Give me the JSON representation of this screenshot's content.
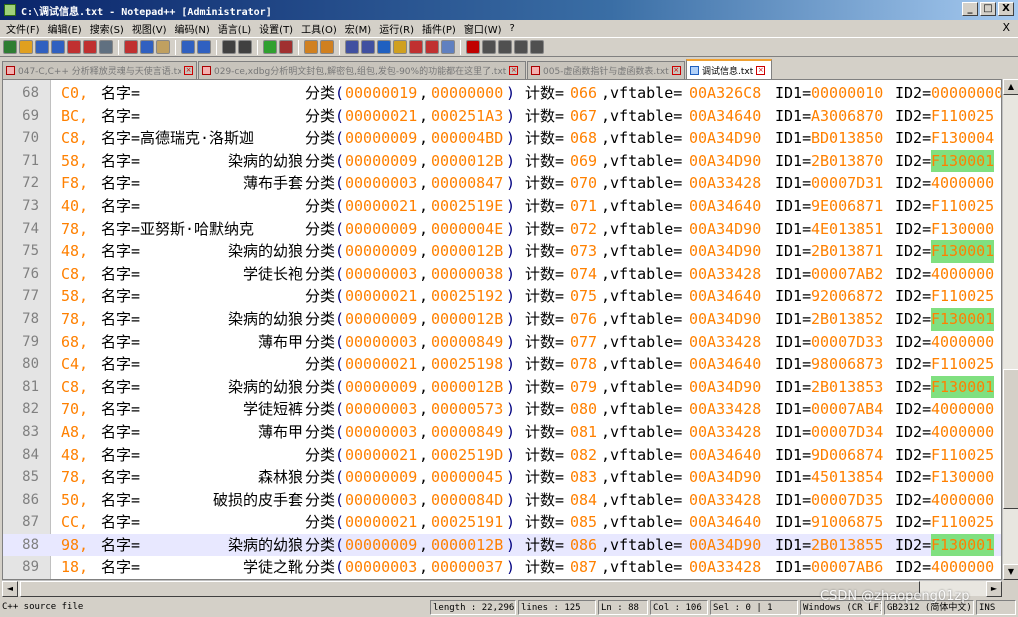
{
  "window": {
    "title": "C:\\调试信息.txt - Notepad++ [Administrator]",
    "buttons": [
      "_",
      "□",
      "X"
    ]
  },
  "menu": {
    "items": [
      "文件(F)",
      "编辑(E)",
      "搜索(S)",
      "视图(V)",
      "编码(N)",
      "语言(L)",
      "设置(T)",
      "工具(O)",
      "宏(M)",
      "运行(R)",
      "插件(P)",
      "窗口(W)",
      "?"
    ],
    "close": "X"
  },
  "toolbar": {
    "icons": [
      "new-file-icon",
      "open-file-icon",
      "save-icon",
      "save-all-icon",
      "close-icon",
      "close-all-icon",
      "print-icon",
      "cut-icon",
      "copy-icon",
      "paste-icon",
      "undo-icon",
      "redo-icon",
      "find-icon",
      "replace-icon",
      "zoom-in-icon",
      "zoom-out-icon",
      "sync-v-icon",
      "sync-h-icon",
      "wrap-icon",
      "all-chars-icon",
      "indent-guide-icon",
      "doc-map-icon",
      "function-list-icon",
      "folder-workspace-icon",
      "monitor-icon",
      "record-macro-icon",
      "stop-macro-icon",
      "play-macro-icon",
      "run-macro-icon",
      "save-macro-icon"
    ],
    "colors": [
      "#2e7d32",
      "#e0a020",
      "#3060c0",
      "#3060c0",
      "#c03030",
      "#c03030",
      "#607080",
      "#c03030",
      "#3060c0",
      "#c0a060",
      "#3060c0",
      "#3060c0",
      "#404040",
      "#404040",
      "#30a030",
      "#a03030",
      "#d08020",
      "#d08020",
      "#4050a0",
      "#4050a0",
      "#2060c0",
      "#d0a020",
      "#c03030",
      "#c03030",
      "#6080c0",
      "#c00000",
      "#505050",
      "#505050",
      "#505050",
      "#505050"
    ]
  },
  "tabs": [
    {
      "label": "047-C,C++ 分析释放灵魂与天使言语.txt",
      "active": false
    },
    {
      "label": "029-ce,xdbg分析明文封包,解密包,组包,发包-90%的功能都在这里了.txt",
      "active": false
    },
    {
      "label": "005-虚函数指针与虚函数表.txt",
      "active": false
    },
    {
      "label": "调试信息.txt",
      "active": true
    }
  ],
  "editor": {
    "current_line": 88,
    "rows": [
      {
        "num": "68",
        "head": "C0,",
        "name": "名字=",
        "item": "",
        "cls_a": "00000019",
        "cls_b": "00000000",
        "count": "066",
        "vft": "00A326C8",
        "id1": "00000010",
        "id2": "00000000",
        "id2_hl": false
      },
      {
        "num": "69",
        "head": "BC,",
        "name": "名字=",
        "item": "",
        "cls_a": "00000021",
        "cls_b": "000251A3",
        "count": "067",
        "vft": "00A34640",
        "id1": "A3006870",
        "id2": "F110025",
        "id2_hl": false
      },
      {
        "num": "70",
        "head": "C8,",
        "name": "名字=高德瑞克·洛斯迦",
        "item": "",
        "cls_a": "00000009",
        "cls_b": "000004BD",
        "count": "068",
        "vft": "00A34D90",
        "id1": "BD013850",
        "id2": "F130004",
        "id2_hl": false
      },
      {
        "num": "71",
        "head": "58,",
        "name": "名字=",
        "item": "染病的幼狼",
        "cls_a": "00000009",
        "cls_b": "0000012B",
        "count": "069",
        "vft": "00A34D90",
        "id1": "2B013870",
        "id2": "F130001",
        "id2_hl": true
      },
      {
        "num": "72",
        "head": "F8,",
        "name": "名字=",
        "item": "薄布手套",
        "cls_a": "00000003",
        "cls_b": "00000847",
        "count": "070",
        "vft": "00A33428",
        "id1": "00007D31",
        "id2": "4000000",
        "id2_hl": false
      },
      {
        "num": "73",
        "head": "40,",
        "name": "名字=",
        "item": "",
        "cls_a": "00000021",
        "cls_b": "0002519E",
        "count": "071",
        "vft": "00A34640",
        "id1": "9E006871",
        "id2": "F110025",
        "id2_hl": false
      },
      {
        "num": "74",
        "head": "78,",
        "name": "名字=亚努斯·哈默纳克",
        "item": "",
        "cls_a": "00000009",
        "cls_b": "0000004E",
        "count": "072",
        "vft": "00A34D90",
        "id1": "4E013851",
        "id2": "F130000",
        "id2_hl": false
      },
      {
        "num": "75",
        "head": "48,",
        "name": "名字=",
        "item": "染病的幼狼",
        "cls_a": "00000009",
        "cls_b": "0000012B",
        "count": "073",
        "vft": "00A34D90",
        "id1": "2B013871",
        "id2": "F130001",
        "id2_hl": true
      },
      {
        "num": "76",
        "head": "C8,",
        "name": "名字=",
        "item": "学徒长袍",
        "cls_a": "00000003",
        "cls_b": "00000038",
        "count": "074",
        "vft": "00A33428",
        "id1": "00007AB2",
        "id2": "4000000",
        "id2_hl": false
      },
      {
        "num": "77",
        "head": "58,",
        "name": "名字=",
        "item": "",
        "cls_a": "00000021",
        "cls_b": "00025192",
        "count": "075",
        "vft": "00A34640",
        "id1": "92006872",
        "id2": "F110025",
        "id2_hl": false
      },
      {
        "num": "78",
        "head": "78,",
        "name": "名字=",
        "item": "染病的幼狼",
        "cls_a": "00000009",
        "cls_b": "0000012B",
        "count": "076",
        "vft": "00A34D90",
        "id1": "2B013852",
        "id2": "F130001",
        "id2_hl": true
      },
      {
        "num": "79",
        "head": "68,",
        "name": "名字=",
        "item": "薄布甲",
        "cls_a": "00000003",
        "cls_b": "00000849",
        "count": "077",
        "vft": "00A33428",
        "id1": "00007D33",
        "id2": "4000000",
        "id2_hl": false
      },
      {
        "num": "80",
        "head": "C4,",
        "name": "名字=",
        "item": "",
        "cls_a": "00000021",
        "cls_b": "00025198",
        "count": "078",
        "vft": "00A34640",
        "id1": "98006873",
        "id2": "F110025",
        "id2_hl": false
      },
      {
        "num": "81",
        "head": "C8,",
        "name": "名字=",
        "item": "染病的幼狼",
        "cls_a": "00000009",
        "cls_b": "0000012B",
        "count": "079",
        "vft": "00A34D90",
        "id1": "2B013853",
        "id2": "F130001",
        "id2_hl": true
      },
      {
        "num": "82",
        "head": "70,",
        "name": "名字=",
        "item": "学徒短裤",
        "cls_a": "00000003",
        "cls_b": "00000573",
        "count": "080",
        "vft": "00A33428",
        "id1": "00007AB4",
        "id2": "4000000",
        "id2_hl": false
      },
      {
        "num": "83",
        "head": "A8,",
        "name": "名字=",
        "item": "薄布甲",
        "cls_a": "00000003",
        "cls_b": "00000849",
        "count": "081",
        "vft": "00A33428",
        "id1": "00007D34",
        "id2": "4000000",
        "id2_hl": false
      },
      {
        "num": "84",
        "head": "48,",
        "name": "名字=",
        "item": "",
        "cls_a": "00000021",
        "cls_b": "0002519D",
        "count": "082",
        "vft": "00A34640",
        "id1": "9D006874",
        "id2": "F110025",
        "id2_hl": false
      },
      {
        "num": "85",
        "head": "78,",
        "name": "名字=",
        "item": "森林狼",
        "cls_a": "00000009",
        "cls_b": "00000045",
        "count": "083",
        "vft": "00A34D90",
        "id1": "45013854",
        "id2": "F130000",
        "id2_hl": false
      },
      {
        "num": "86",
        "head": "50,",
        "name": "名字=",
        "item": "破损的皮手套",
        "cls_a": "00000003",
        "cls_b": "0000084D",
        "count": "084",
        "vft": "00A33428",
        "id1": "00007D35",
        "id2": "4000000",
        "id2_hl": false
      },
      {
        "num": "87",
        "head": "CC,",
        "name": "名字=",
        "item": "",
        "cls_a": "00000021",
        "cls_b": "00025191",
        "count": "085",
        "vft": "00A34640",
        "id1": "91006875",
        "id2": "F110025",
        "id2_hl": false
      },
      {
        "num": "88",
        "head": "98,",
        "name": "名字=",
        "item": "染病的幼狼",
        "cls_a": "00000009",
        "cls_b": "0000012B",
        "count": "086",
        "vft": "00A34D90",
        "id1": "2B013855",
        "id2": "F130001",
        "id2_hl": true
      },
      {
        "num": "89",
        "head": "18,",
        "name": "名字=",
        "item": "学徒之靴",
        "cls_a": "00000003",
        "cls_b": "00000037",
        "count": "087",
        "vft": "00A33428",
        "id1": "00007AB6",
        "id2": "4000000",
        "id2_hl": false
      }
    ],
    "labels": {
      "cls": "分类",
      "count": "计数=",
      "vft": ",vftable=",
      "id1": "ID1=",
      "id2": "ID2="
    }
  },
  "status": {
    "lang": "C++ source file",
    "length": "length : 22,296",
    "lines": "lines : 125",
    "ln": "Ln : 88",
    "col": "Col : 106",
    "sel": "Sel : 0 | 1",
    "eol": "Windows (CR LF)",
    "enc": "GB2312 (简体中文)",
    "ins": "INS"
  },
  "watermark": "CSDN @zhaopeng01zp"
}
